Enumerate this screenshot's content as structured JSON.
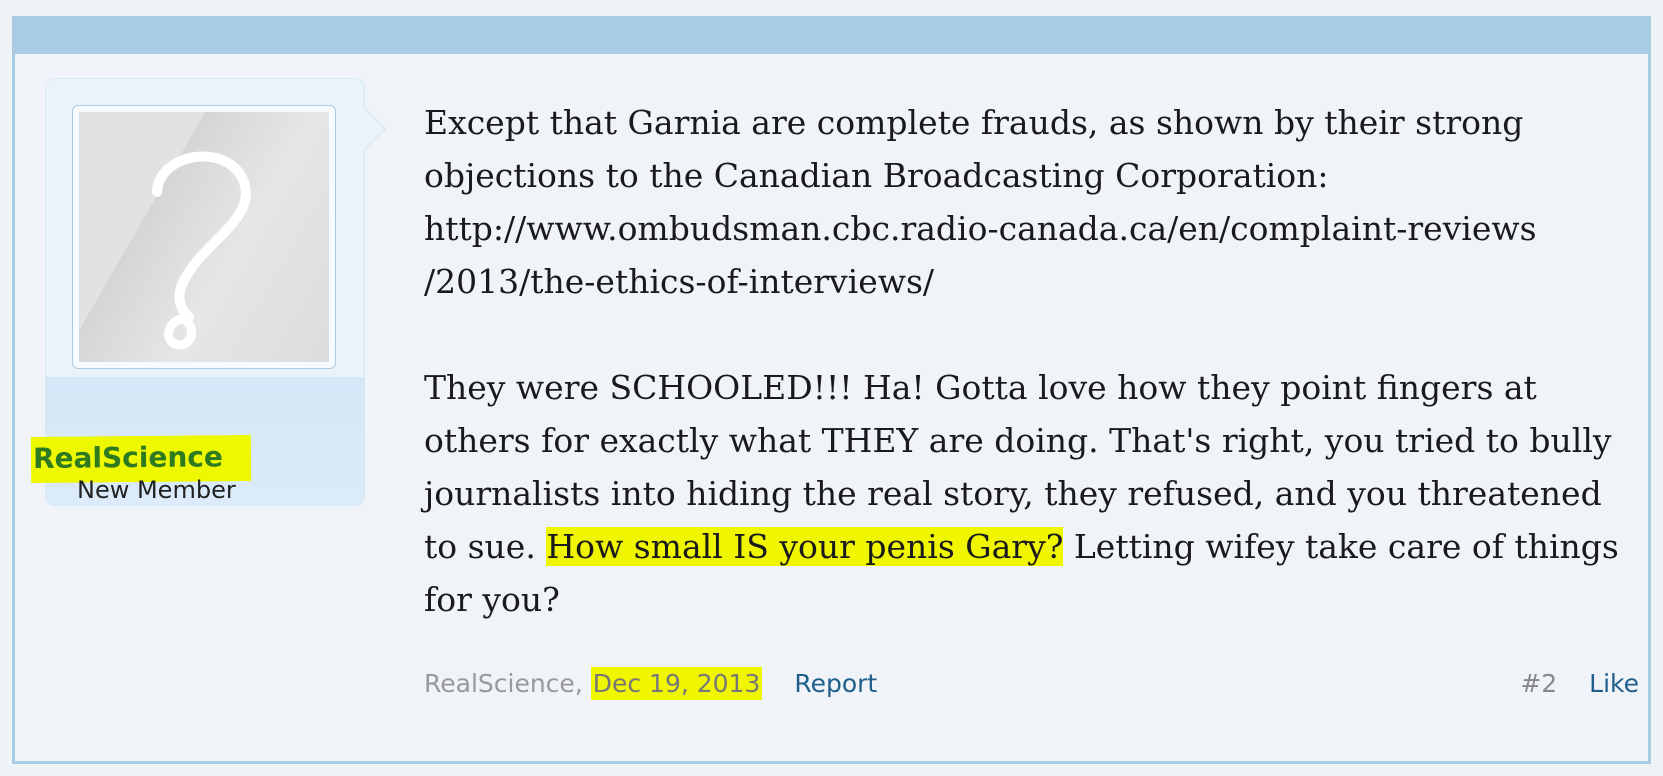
{
  "user": {
    "name": "RealScience",
    "title": "New Member"
  },
  "message": {
    "p1_lines": [
      "Except that Garnia are complete frauds, as shown by their strong",
      "objections to the Canadian Broadcasting Corporation:",
      "http://www.ombudsman.cbc.radio-canada.ca/en/complaint-reviews",
      "/2013/the-ethics-of-interviews/"
    ],
    "p2_line1": "They were SCHOOLED!!! Ha! Gotta love how they point fingers at",
    "p2_line2": "others for exactly what THEY are doing. That's right, you tried to bully",
    "p2_line3": "journalists into hiding the real story, they refused, and you threatened",
    "p2_line4_before": "to sue. ",
    "p2_line4_highlight": "How small IS your penis Gary?",
    "p2_line4_after": " Letting wifey take care of things",
    "p2_line5": "for you?"
  },
  "meta": {
    "author": "RealScience",
    "separator": ",",
    "date": "Dec 19, 2013",
    "report_label": "Report",
    "post_number": "#2",
    "like_label": "Like"
  },
  "colors": {
    "header_bar": "#a9cbe4",
    "highlight": "#f0f500",
    "username": "#2e7a21",
    "link": "#1f5f8b"
  },
  "icons": {
    "avatar": "question-mark-avatar-icon"
  }
}
